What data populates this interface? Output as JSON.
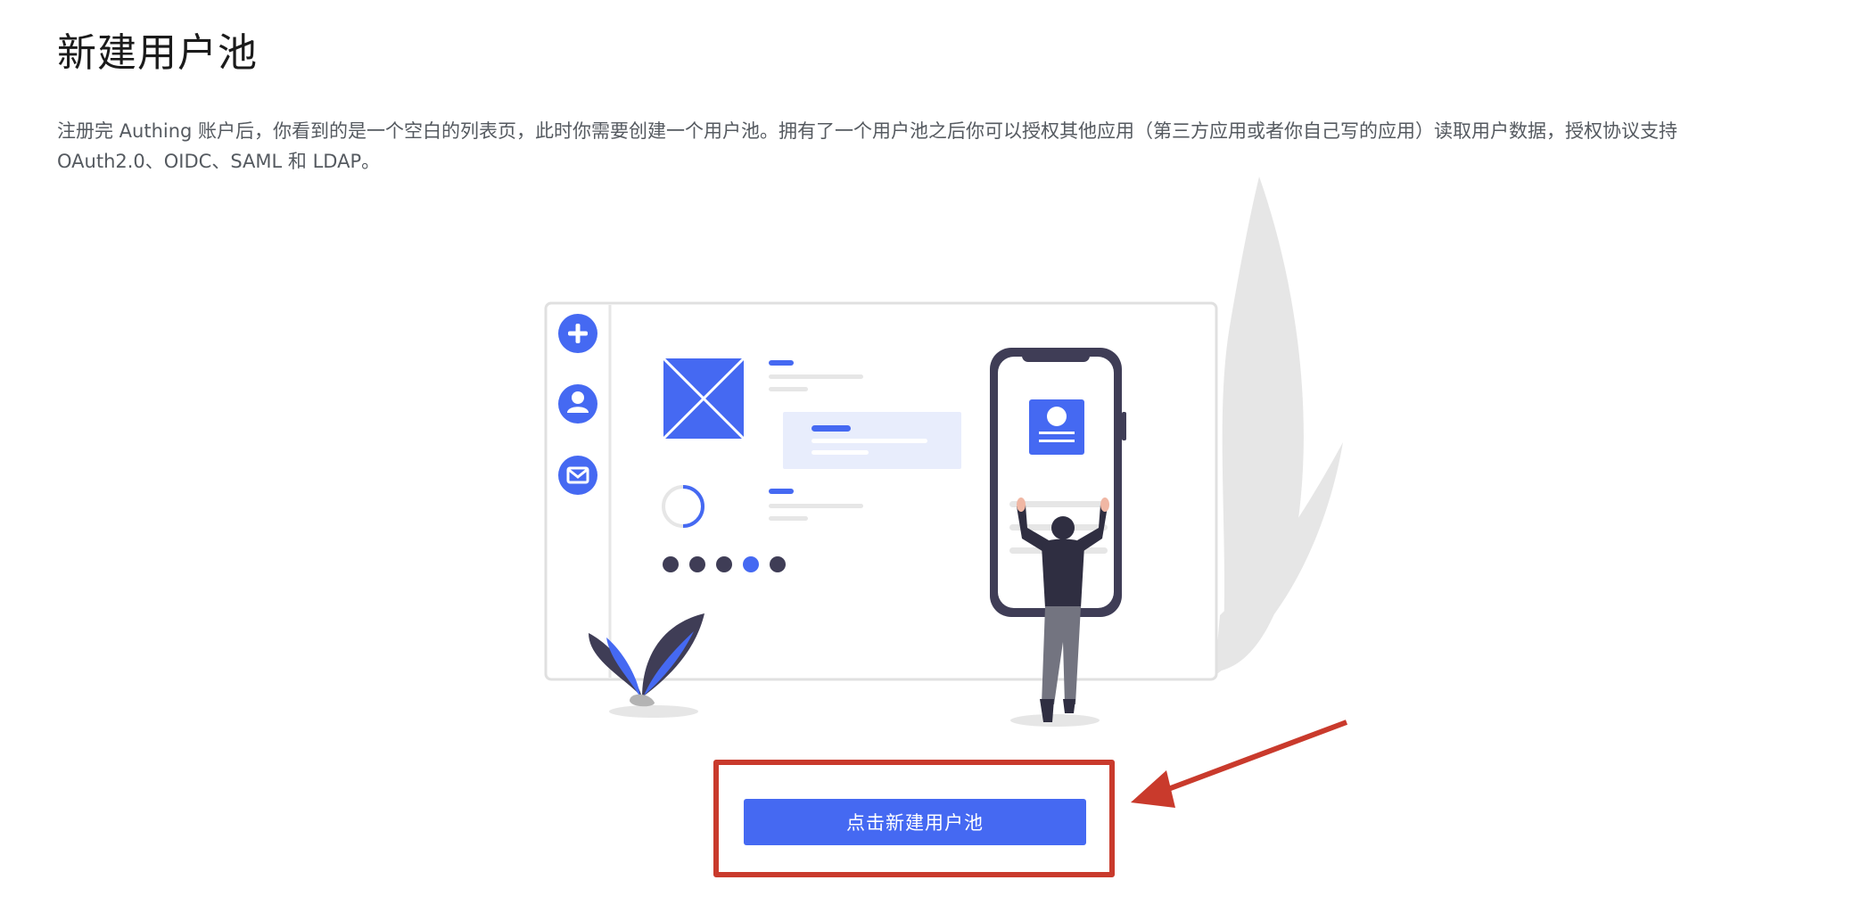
{
  "page": {
    "title": "新建用户池",
    "description": "注册完 Authing 账户后，你看到的是一个空白的列表页，此时你需要创建一个用户池。拥有了一个用户池之后你可以授权其他应用（第三方应用或者你自己写的应用）读取用户数据，授权协议支持 OAuth2.0、OIDC、SAML 和 LDAP。"
  },
  "cta": {
    "label": "点击新建用户池"
  },
  "colors": {
    "primary": "#4569f2",
    "highlight": "#c93a2c",
    "dark": "#3f3d56",
    "muted": "#e6e6e6"
  },
  "illustration": {
    "sidebar_icons": [
      "plus-icon",
      "user-icon",
      "mail-icon"
    ],
    "dots_active_index": 3
  }
}
